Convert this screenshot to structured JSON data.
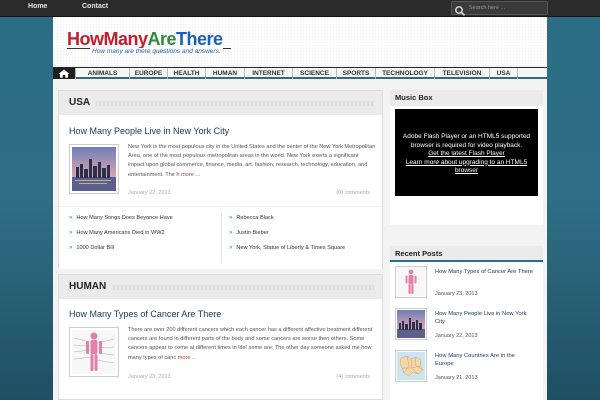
{
  "topbar": {
    "links": [
      "Home",
      "Contact"
    ],
    "search_placeholder": "Search here ..."
  },
  "header": {
    "logo_parts": [
      "HowMany",
      "Are",
      "There"
    ],
    "tagline": "How many are there questions and answers."
  },
  "nav": {
    "home_icon": "home-icon",
    "items": [
      "ANIMALS",
      "EUROPE",
      "HEALTH",
      "HUMAN",
      "INTERNET",
      "SCIENCE",
      "SPORTS",
      "TECHNOLOGY",
      "TELEVISION",
      "USA"
    ]
  },
  "sections": [
    {
      "title": "USA",
      "post": {
        "title": "How Many People Live in New York City",
        "excerpt": "New York is the most populous city in the United States and the center of the New York Metropolitan Area, one of the most populous metropolitan areas in the world. New York exerts a significant impact upon global commerce, finance, media, art, fashion, research, technology, education, and entertainment. The h",
        "more": "more ...",
        "date": "January 22, 2013",
        "comments": "(0) comments"
      },
      "links_left": [
        "How Many Songs Does Beyonce Have",
        "How Many Americans Died in WW2",
        "1000 Dollar Bill"
      ],
      "links_right": [
        "Rebecca Black",
        "Justin Bieber",
        "New York, Statue of Liberty & Times Square"
      ]
    },
    {
      "title": "HUMAN",
      "post": {
        "title": "How Many Types of Cancer Are There",
        "excerpt": "There are over 200 different cancers which each cancer has a different affective treatment different cancers are found in different parts of the body and some cancers are worse then others. Some cancers appear to come at different times in life! some are: The other day someone asked me how many types of canc",
        "more": "more ...",
        "date": "January 23, 2013",
        "comments": "(4) comments"
      }
    }
  ],
  "sidebar": {
    "music_box": {
      "title": "Music Box",
      "flash_line1": "Adobe Flash Player or an HTML5 supported browser is required for video playback.",
      "flash_link1": "Get the latest Flash Player",
      "flash_link2": "Learn more about upgrading to an HTML5 browser"
    },
    "recent_posts": {
      "title": "Recent Posts",
      "items": [
        {
          "title": "How Many Types of Cancer Are There",
          "date": "January 23, 2013"
        },
        {
          "title": "How Many People Live in New York City",
          "date": "January 22, 2013"
        },
        {
          "title": "How Many Countries Are in the Europe",
          "date": "January 21, 2013"
        }
      ]
    }
  },
  "colors": {
    "background": "#2b6d86",
    "nav_accent": "#2d6b8a",
    "link": "#1b3a63",
    "more": "#c0392b",
    "logo_red": "#c81c2c",
    "logo_green": "#2c8b3c",
    "logo_blue": "#1c5fb3"
  }
}
